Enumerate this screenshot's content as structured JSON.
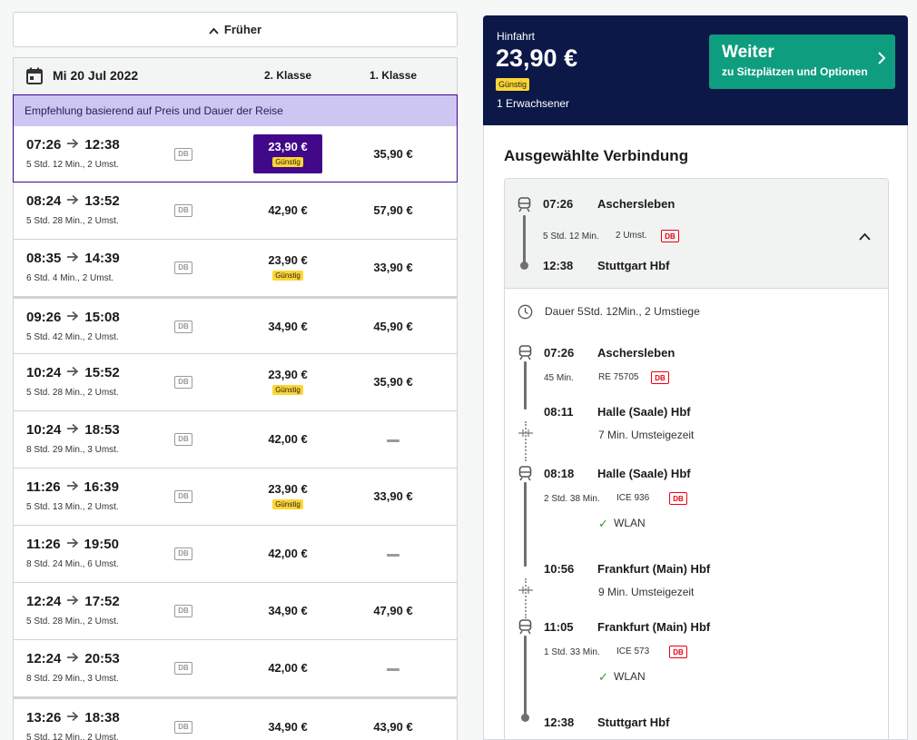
{
  "earlier_label": "Früher",
  "date_label": "Mi 20 Jul 2022",
  "col_2nd": "2. Klasse",
  "col_1st": "1. Klasse",
  "recommendation": "Empfehlung basierend auf Preis und Dauer der Reise",
  "operator_logo": "DB",
  "cheap_badge": "Günstig",
  "rows": [
    {
      "dep": "07:26",
      "arr": "12:38",
      "dur": "5 Std. 12 Min., 2 Umst.",
      "p2": "23,90 €",
      "cheap": true,
      "p1": "35,90 €",
      "selected": true
    },
    {
      "dep": "08:24",
      "arr": "13:52",
      "dur": "5 Std. 28 Min., 2 Umst.",
      "p2": "42,90 €",
      "cheap": false,
      "p1": "57,90 €"
    },
    {
      "dep": "08:35",
      "arr": "14:39",
      "dur": "6 Std. 4 Min., 2 Umst.",
      "p2": "23,90 €",
      "cheap": true,
      "p1": "33,90 €"
    },
    {
      "dep": "09:26",
      "arr": "15:08",
      "dur": "5 Std. 42 Min., 2 Umst.",
      "p2": "34,90 €",
      "cheap": false,
      "p1": "45,90 €",
      "sep": true
    },
    {
      "dep": "10:24",
      "arr": "15:52",
      "dur": "5 Std. 28 Min., 2 Umst.",
      "p2": "23,90 €",
      "cheap": true,
      "p1": "35,90 €"
    },
    {
      "dep": "10:24",
      "arr": "18:53",
      "dur": "8 Std. 29 Min., 3 Umst.",
      "p2": "42,00 €",
      "cheap": false,
      "p1": null
    },
    {
      "dep": "11:26",
      "arr": "16:39",
      "dur": "5 Std. 13 Min., 2 Umst.",
      "p2": "23,90 €",
      "cheap": true,
      "p1": "33,90 €"
    },
    {
      "dep": "11:26",
      "arr": "19:50",
      "dur": "8 Std. 24 Min., 6 Umst.",
      "p2": "42,00 €",
      "cheap": false,
      "p1": null
    },
    {
      "dep": "12:24",
      "arr": "17:52",
      "dur": "5 Std. 28 Min., 2 Umst.",
      "p2": "34,90 €",
      "cheap": false,
      "p1": "47,90 €"
    },
    {
      "dep": "12:24",
      "arr": "20:53",
      "dur": "8 Std. 29 Min., 3 Umst.",
      "p2": "42,00 €",
      "cheap": false,
      "p1": null
    },
    {
      "dep": "13:26",
      "arr": "18:38",
      "dur": "5 Std. 12 Min., 2 Umst.",
      "p2": "34,90 €",
      "cheap": false,
      "p1": "43,90 €",
      "sep": true
    }
  ],
  "summary": {
    "label": "Hinfahrt",
    "total": "23,90 €",
    "badge": "Günstig",
    "passengers": "1 Erwachsener",
    "continue_title": "Weiter",
    "continue_sub": "zu Sitzplätzen und Optionen"
  },
  "details": {
    "title": "Ausgewählte Verbindung",
    "overview": {
      "dep_time": "07:26",
      "dep_station": "Aschersleben",
      "duration": "5 Std. 12 Min.",
      "changes": "2 Umst.",
      "arr_time": "12:38",
      "arr_station": "Stuttgart Hbf"
    },
    "summary_line": "Dauer 5Std. 12Min., 2 Umstiege",
    "legs": [
      {
        "dep_time": "07:26",
        "dep_station": "Aschersleben",
        "duration": "45 Min.",
        "train": "RE 75705",
        "wlan": null,
        "arr_time": "08:11",
        "arr_station": "Halle (Saale) Hbf",
        "transfer": "7 Min. Umsteigezeit"
      },
      {
        "dep_time": "08:18",
        "dep_station": "Halle (Saale) Hbf",
        "duration": "2 Std. 38 Min.",
        "train": "ICE 936",
        "wlan": "WLAN",
        "arr_time": "10:56",
        "arr_station": "Frankfurt (Main) Hbf",
        "transfer": "9 Min. Umsteigezeit"
      },
      {
        "dep_time": "11:05",
        "dep_station": "Frankfurt (Main) Hbf",
        "duration": "1 Std. 33 Min.",
        "train": "ICE 573",
        "wlan": "WLAN",
        "arr_time": "12:38",
        "arr_station": "Stuttgart Hbf",
        "transfer": null
      }
    ]
  },
  "colors": {
    "selected_purple": "#41088a",
    "banner_lilac": "#cdc6f2",
    "navy": "#0c1847",
    "teal": "#0f9d7f",
    "badge_yellow": "#fcd535",
    "db_red": "#ec0016"
  }
}
